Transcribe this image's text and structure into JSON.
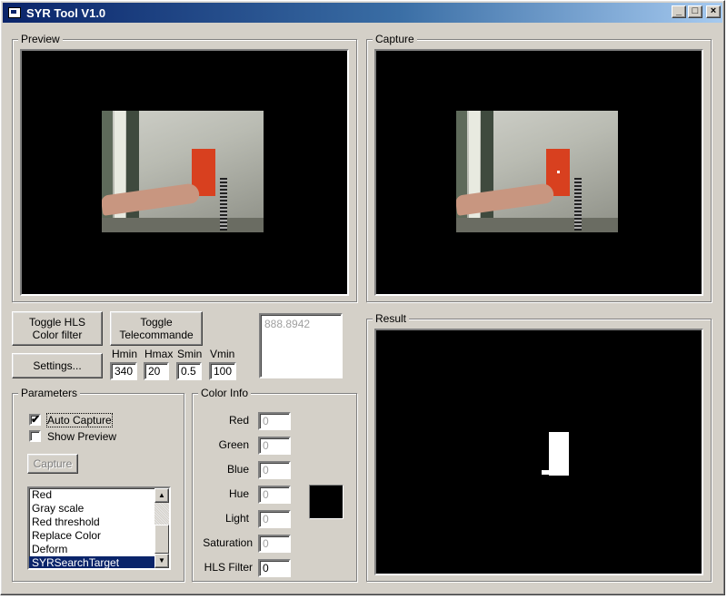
{
  "window": {
    "title": "SYR Tool V1.0",
    "controls": {
      "minimize": "_",
      "maximize": "□",
      "close": "×"
    }
  },
  "preview": {
    "label": "Preview"
  },
  "capture": {
    "label": "Capture"
  },
  "result": {
    "label": "Result"
  },
  "toolbar": {
    "toggle_hls_line1": "Toggle HLS",
    "toggle_hls_line2": "Color filter",
    "toggle_tele_line1": "Toggle",
    "toggle_tele_line2": "Telecommande",
    "settings": "Settings..."
  },
  "hls_range": {
    "hmin_label": "Hmin",
    "hmax_label": "Hmax",
    "smin_label": "Smin",
    "vmin_label": "Vmin",
    "hmin": "340",
    "hmax": "20",
    "smin": "0.5",
    "vmin": "100"
  },
  "readout": {
    "value": "888.8942"
  },
  "parameters": {
    "label": "Parameters",
    "auto_capture_label": "Auto Capture",
    "auto_capture_checked": true,
    "show_preview_label": "Show Preview",
    "show_preview_checked": false,
    "capture_button": "Capture",
    "filters": [
      "Red",
      "Gray scale",
      "Red threshold",
      "Replace Color",
      "Deform",
      "SYRSearchTarget"
    ],
    "selected_filter": "SYRSearchTarget"
  },
  "color_info": {
    "label": "Color Info",
    "red_label": "Red",
    "red": "0",
    "green_label": "Green",
    "green": "0",
    "blue_label": "Blue",
    "blue": "0",
    "hue_label": "Hue",
    "hue": "0",
    "light_label": "Light",
    "light": "0",
    "saturation_label": "Saturation",
    "saturation": "0",
    "hls_filter_label": "HLS Filter",
    "hls_filter": "0",
    "swatch_color": "#000000"
  },
  "colors": {
    "title_gradient_start": "#0a246a",
    "title_gradient_end": "#a6caf0",
    "face": "#d4d0c8",
    "selection": "#0a246a"
  }
}
